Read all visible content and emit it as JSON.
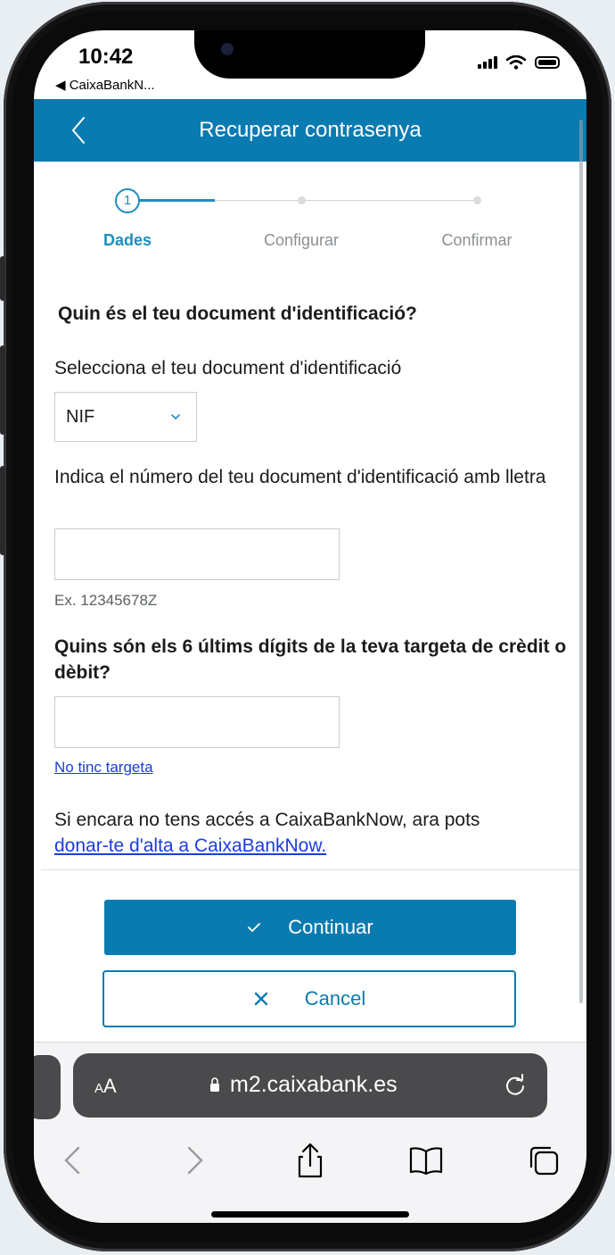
{
  "status_bar": {
    "time": "10:42",
    "back_app": "◀ CaixaBankN..."
  },
  "app_bar": {
    "title": "Recuperar contrasenya"
  },
  "stepper": {
    "current_step_number": "1",
    "steps": [
      {
        "label": "Dades",
        "active": true
      },
      {
        "label": "Configurar",
        "active": false
      },
      {
        "label": "Confirmar",
        "active": false
      }
    ]
  },
  "form": {
    "heading": "Quin és el teu document d'identificació?",
    "doc_type_label": "Selecciona el teu document d'identificació",
    "doc_type_value": "NIF",
    "doc_number_label": "Indica el número del teu document d'identificació amb lletra",
    "doc_number_value": "",
    "doc_number_hint": "Ex. 12345678Z",
    "card_digits_label": "Quins són els 6 últims dígits de la teva targeta de crèdit o dèbit?",
    "card_digits_value": "",
    "no_card_link": "No tinc targeta",
    "signup_text": "Si encara no tens accés a CaixaBankNow, ara pots",
    "signup_link": "donar-te d'alta a CaixaBankNow."
  },
  "actions": {
    "continue_label": "Continuar",
    "cancel_label": "Cancel"
  },
  "browser": {
    "text_size_label_big": "A",
    "text_size_label_small": "A",
    "domain": "m2.caixabank.es"
  },
  "colors": {
    "brand": "#0a7bb0",
    "step_active": "#1e8fbd",
    "link": "#1a3de0"
  },
  "icons": [
    "chevron-left-icon",
    "chevron-down-icon",
    "check-icon",
    "close-icon",
    "lock-icon",
    "reload-icon",
    "share-icon",
    "bookmarks-icon",
    "tabs-icon"
  ]
}
